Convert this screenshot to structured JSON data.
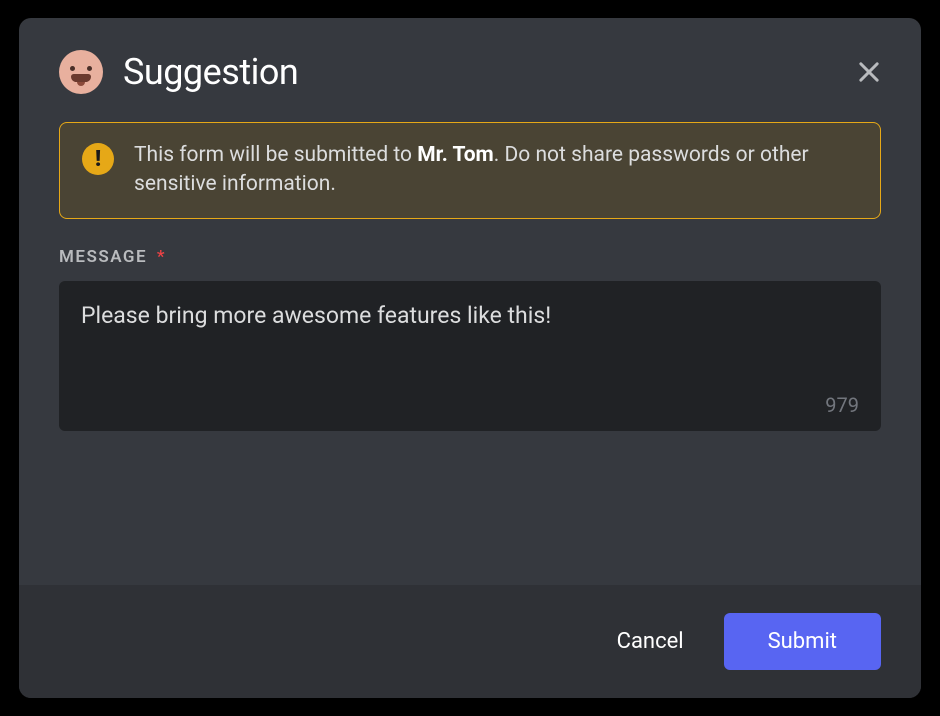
{
  "modal": {
    "title": "Suggestion",
    "close_aria": "Close"
  },
  "warning": {
    "text_before": "This form will be submitted to ",
    "recipient": "Mr. Tom",
    "text_after": ". Do not share passwords or other sensitive information."
  },
  "field": {
    "label": "MESSAGE",
    "required": "*",
    "char_count": "979",
    "value": "Please bring more awesome features like this!"
  },
  "actions": {
    "cancel_label": "Cancel",
    "submit_label": "Submit"
  },
  "colors": {
    "accent": "#5865f2",
    "warning": "#e6a817",
    "danger": "#ed4245"
  }
}
